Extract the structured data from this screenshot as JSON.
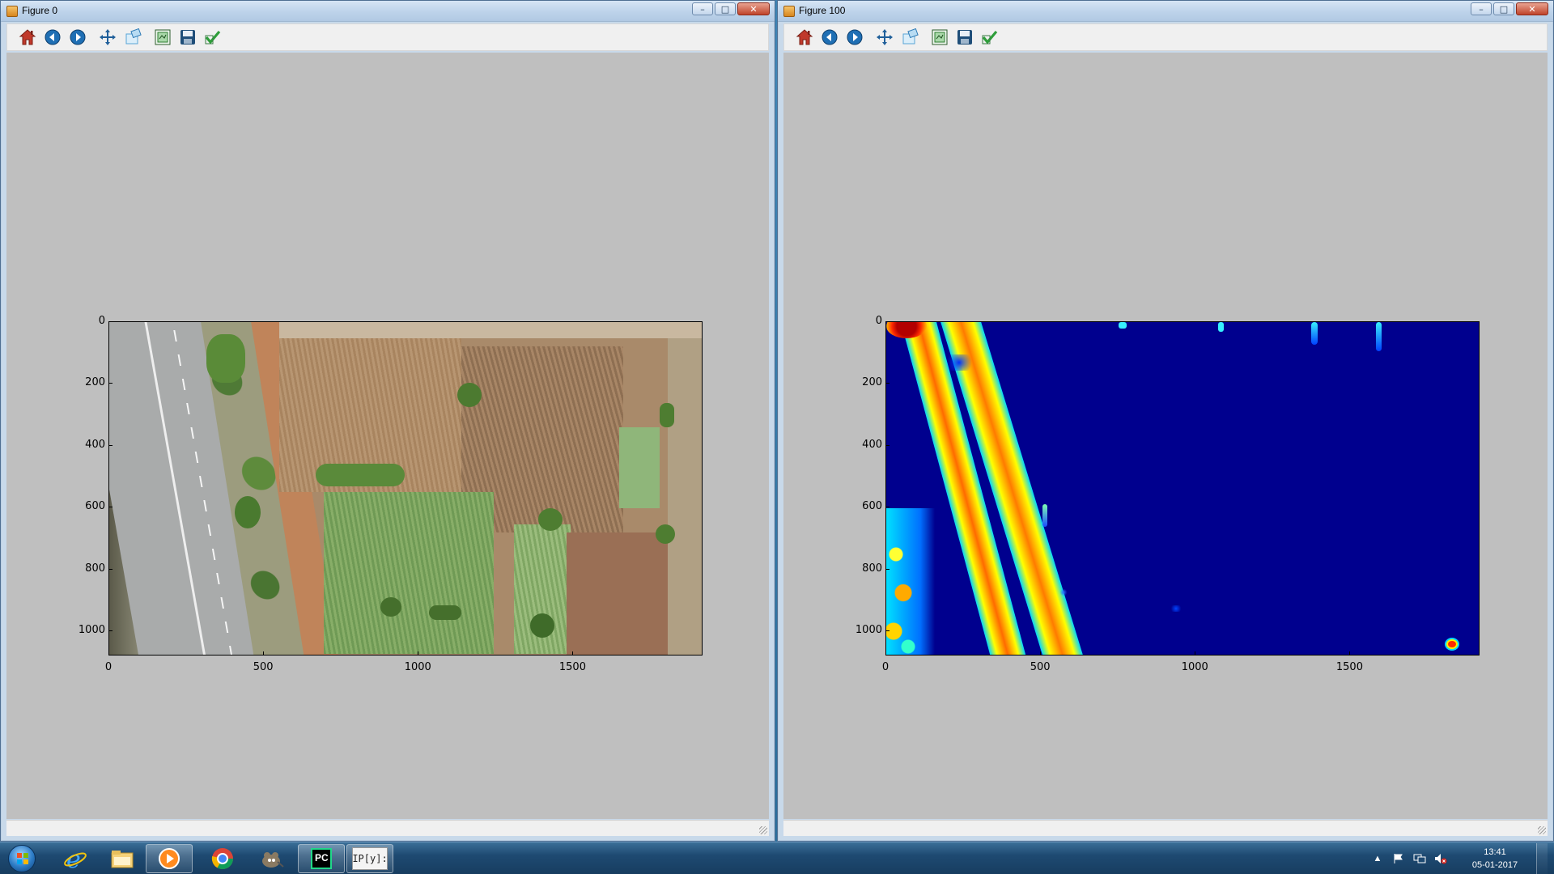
{
  "windows": [
    {
      "id": "left",
      "title": "Figure 0",
      "content": "aerial-photo",
      "axes": {
        "x_ticks": [
          "0",
          "500",
          "1000",
          "1500"
        ],
        "y_ticks": [
          "0",
          "200",
          "400",
          "600",
          "800",
          "1000"
        ],
        "xlim": [
          0,
          1920
        ],
        "ylim": [
          1080,
          0
        ]
      }
    },
    {
      "id": "right",
      "title": "Figure 100",
      "content": "jet-heatmap",
      "axes": {
        "x_ticks": [
          "0",
          "500",
          "1000",
          "1500"
        ],
        "y_ticks": [
          "0",
          "200",
          "400",
          "600",
          "800",
          "1000"
        ],
        "xlim": [
          0,
          1920
        ],
        "ylim": [
          1080,
          0
        ]
      }
    }
  ],
  "window_controls": {
    "minimize": "–",
    "maximize": "□",
    "close": "✕"
  },
  "toolbar_buttons": [
    {
      "name": "home-icon",
      "color": "#c0392b"
    },
    {
      "name": "back-icon",
      "color": "#1f6fb4"
    },
    {
      "name": "forward-icon",
      "color": "#1f6fb4"
    },
    {
      "name": "pan-icon",
      "color": "#1f5f9a"
    },
    {
      "name": "zoom-icon",
      "color": "#5aa5d6"
    },
    {
      "name": "configure-subplots-icon",
      "color": "#2e7d32"
    },
    {
      "name": "save-icon",
      "color": "#1f4e79"
    },
    {
      "name": "edit-check-icon",
      "color": "#2e9e3a"
    }
  ],
  "taskbar": {
    "apps": [
      {
        "name": "internet-explorer-icon",
        "open": false
      },
      {
        "name": "file-explorer-icon",
        "open": false
      },
      {
        "name": "media-player-icon",
        "open": true
      },
      {
        "name": "chrome-icon",
        "open": false
      },
      {
        "name": "gimp-icon",
        "open": false
      },
      {
        "name": "pycharm-icon",
        "open": true,
        "label": "PC"
      },
      {
        "name": "ipython-icon",
        "open": true,
        "label": "IP[y]:"
      }
    ],
    "tray_icons": [
      "show-hidden-icons-icon",
      "action-center-flag-icon",
      "network-icon",
      "volume-muted-icon"
    ],
    "clock": {
      "time": "13:41",
      "date": "05-01-2017"
    }
  }
}
